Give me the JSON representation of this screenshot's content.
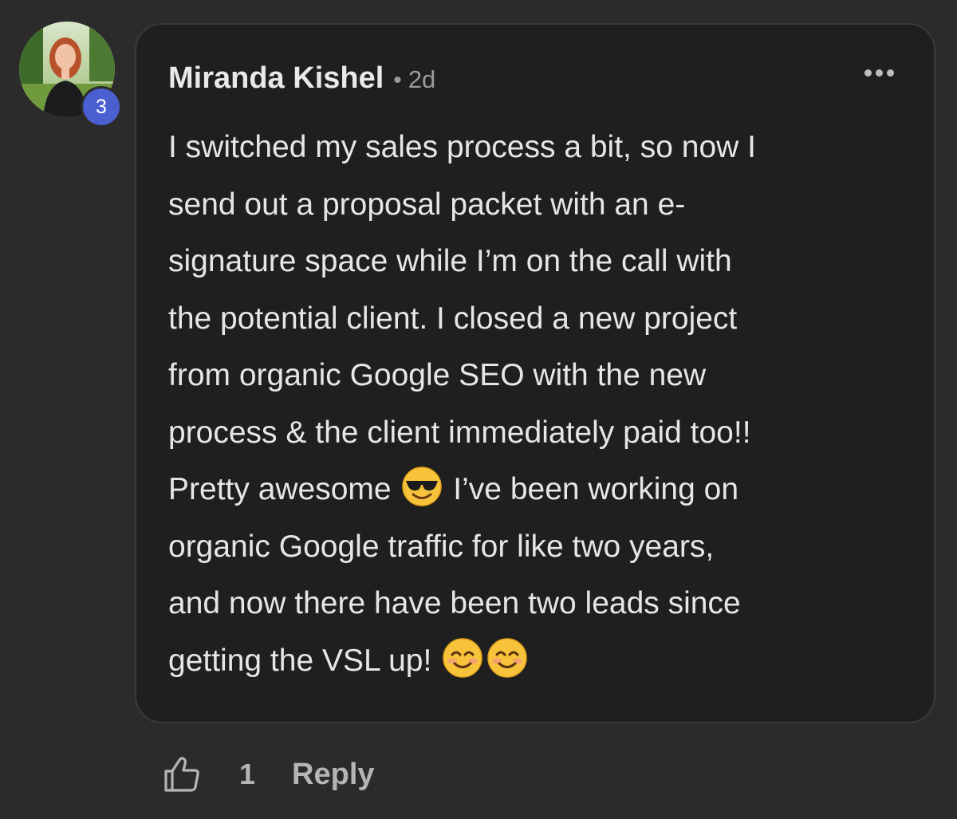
{
  "comment": {
    "author": "Miranda Kishel",
    "separator": "•",
    "timestamp": "2d",
    "level": "3",
    "more_icon": "more-horizontal-icon",
    "text_part1": "I switched my sales process a bit, so now I\nsend out a proposal packet with an e-\nsignature space while I’m on the call with\nthe potential client. I closed a new project\nfrom organic Google SEO with the new\nprocess & the client immediately paid too!!\nPretty awesome ",
    "emoji1": "smiling-face-with-sunglasses",
    "text_part2": " I’ve been working on\norganic Google traffic for like two years,\nand now there have been two leads since\ngetting the VSL up! ",
    "emoji2": "smiling-face-with-smiling-eyes",
    "emoji3": "smiling-face-with-smiling-eyes"
  },
  "footer": {
    "like_icon": "thumbs-up-icon",
    "like_count": "1",
    "reply_label": "Reply"
  },
  "colors": {
    "background": "#2b2b2b",
    "bubble": "#1f1f1f",
    "badge": "#4a5fd0"
  }
}
